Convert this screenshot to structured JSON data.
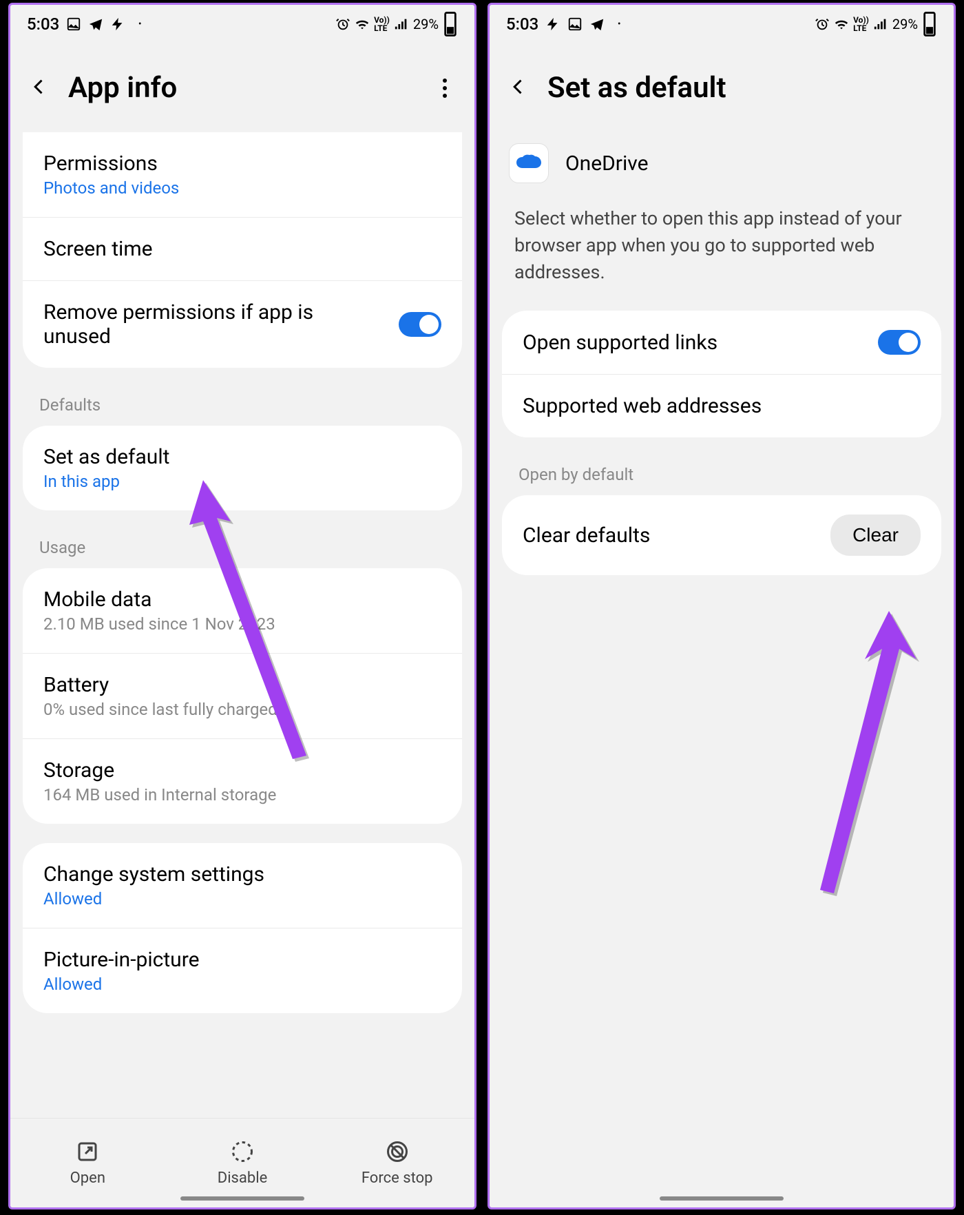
{
  "status": {
    "time": "5:03",
    "battery_pct": "29%"
  },
  "left": {
    "title": "App info",
    "permissions": {
      "title": "Permissions",
      "sub": "Photos and videos"
    },
    "screen_time": {
      "title": "Screen time"
    },
    "remove_perms": {
      "title": "Remove permissions if app is unused"
    },
    "section_defaults": "Defaults",
    "set_default": {
      "title": "Set as default",
      "sub": "In this app"
    },
    "section_usage": "Usage",
    "mobile_data": {
      "title": "Mobile data",
      "sub": "2.10 MB used since 1 Nov 2023"
    },
    "battery": {
      "title": "Battery",
      "sub": "0% used since last fully charged"
    },
    "storage": {
      "title": "Storage",
      "sub": "164 MB used in Internal storage"
    },
    "change_sys": {
      "title": "Change system settings",
      "sub": "Allowed"
    },
    "pip": {
      "title": "Picture-in-picture",
      "sub": "Allowed"
    },
    "actions": {
      "open": "Open",
      "disable": "Disable",
      "force_stop": "Force stop"
    }
  },
  "right": {
    "title": "Set as default",
    "app_name": "OneDrive",
    "description": "Select whether to open this app instead of your browser app when you go to supported web addresses.",
    "open_links": "Open supported links",
    "supported_addr": "Supported web addresses",
    "section_open_default": "Open by default",
    "clear_defaults": "Clear defaults",
    "clear_btn": "Clear"
  }
}
